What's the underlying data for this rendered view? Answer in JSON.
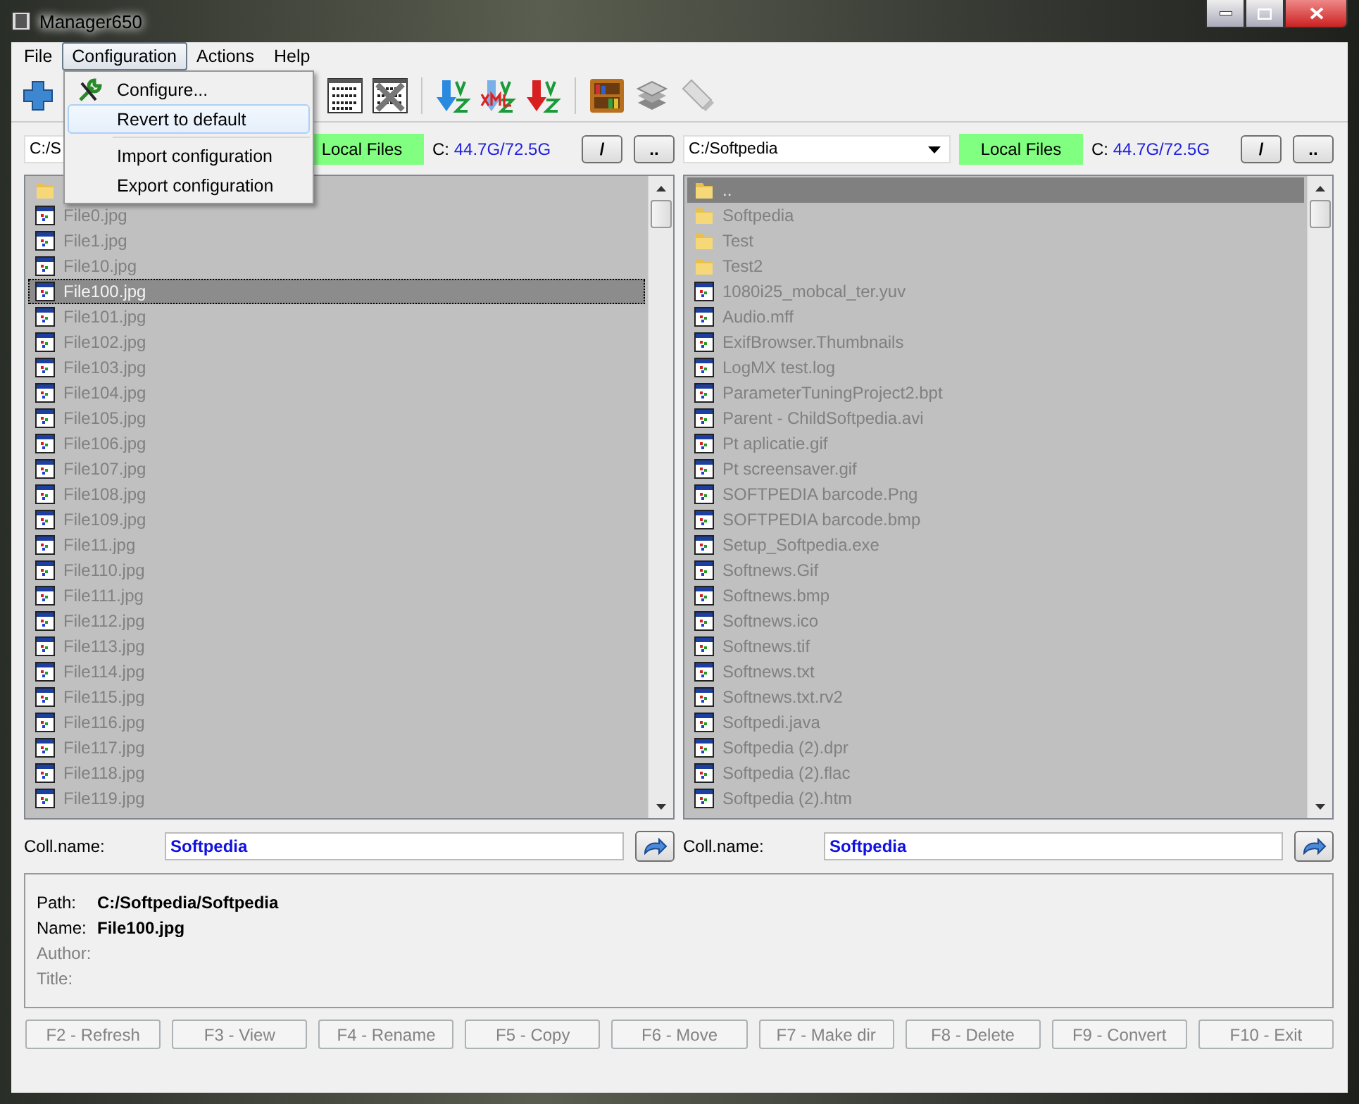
{
  "window": {
    "title": "Manager650"
  },
  "menubar": [
    {
      "label": "File",
      "selected": false
    },
    {
      "label": "Configuration",
      "selected": true
    },
    {
      "label": "Actions",
      "selected": false
    },
    {
      "label": "Help",
      "selected": false
    }
  ],
  "menu": {
    "items": [
      {
        "kind": "tool",
        "label": "Configure...",
        "selected": false
      },
      {
        "kind": "plain",
        "label": "Revert to default",
        "selected": true
      },
      {
        "kind": "separator"
      },
      {
        "kind": "plain",
        "label": "Import configuration",
        "selected": false
      },
      {
        "kind": "plain",
        "label": "Export configuration",
        "selected": false
      }
    ]
  },
  "toolbar": [
    {
      "kind": "add"
    },
    {
      "kind": "gap"
    },
    {
      "kind": "numbered"
    },
    {
      "kind": "numbered-off"
    },
    {
      "kind": "separator"
    },
    {
      "kind": "sort-blue"
    },
    {
      "kind": "sort-xml"
    },
    {
      "kind": "sort-red"
    },
    {
      "kind": "separator"
    },
    {
      "kind": "bookshelf"
    },
    {
      "kind": "stack"
    },
    {
      "kind": "usb"
    }
  ],
  "panels": [
    {
      "path": "C:/S",
      "source": "Local Files",
      "drive": "C:",
      "free": "44.7G/72.5G",
      "root_button": "/",
      "up_button": "..",
      "focused": true,
      "rows": [
        {
          "kind": "folder"
        },
        {
          "kind": "file",
          "name": "File0.jpg",
          "selected": false
        },
        {
          "kind": "file",
          "name": "File1.jpg",
          "selected": false
        },
        {
          "kind": "file",
          "name": "File10.jpg",
          "selected": false
        },
        {
          "kind": "file",
          "name": "File100.jpg",
          "selected": true
        },
        {
          "kind": "file",
          "name": "File101.jpg",
          "selected": false
        },
        {
          "kind": "file",
          "name": "File102.jpg",
          "selected": false
        },
        {
          "kind": "file",
          "name": "File103.jpg",
          "selected": false
        },
        {
          "kind": "file",
          "name": "File104.jpg",
          "selected": false
        },
        {
          "kind": "file",
          "name": "File105.jpg",
          "selected": false
        },
        {
          "kind": "file",
          "name": "File106.jpg",
          "selected": false
        },
        {
          "kind": "file",
          "name": "File107.jpg",
          "selected": false
        },
        {
          "kind": "file",
          "name": "File108.jpg",
          "selected": false
        },
        {
          "kind": "file",
          "name": "File109.jpg",
          "selected": false
        },
        {
          "kind": "file",
          "name": "File11.jpg",
          "selected": false
        },
        {
          "kind": "file",
          "name": "File110.jpg",
          "selected": false
        },
        {
          "kind": "file",
          "name": "File111.jpg",
          "selected": false
        },
        {
          "kind": "file",
          "name": "File112.jpg",
          "selected": false
        },
        {
          "kind": "file",
          "name": "File113.jpg",
          "selected": false
        },
        {
          "kind": "file",
          "name": "File114.jpg",
          "selected": false
        },
        {
          "kind": "file",
          "name": "File115.jpg",
          "selected": false
        },
        {
          "kind": "file",
          "name": "File116.jpg",
          "selected": false
        },
        {
          "kind": "file",
          "name": "File117.jpg",
          "selected": false
        },
        {
          "kind": "file",
          "name": "File118.jpg",
          "selected": false
        },
        {
          "kind": "file",
          "name": "File119.jpg",
          "selected": false
        }
      ],
      "coll_label": "Coll.name:",
      "coll_value": "Softpedia"
    },
    {
      "path": "C:/Softpedia",
      "source": "Local Files",
      "drive": "C:",
      "free": "44.7G/72.5G",
      "root_button": "/",
      "up_button": "..",
      "focused": false,
      "rows": [
        {
          "kind": "folder",
          "name": "..",
          "selected": true
        },
        {
          "kind": "folder",
          "name": "Softpedia",
          "selected": false
        },
        {
          "kind": "folder",
          "name": "Test",
          "selected": false
        },
        {
          "kind": "folder",
          "name": "Test2",
          "selected": false
        },
        {
          "kind": "file",
          "name": "1080i25_mobcal_ter.yuv",
          "selected": false
        },
        {
          "kind": "file",
          "name": "Audio.mff",
          "selected": false
        },
        {
          "kind": "file",
          "name": "ExifBrowser.Thumbnails",
          "selected": false
        },
        {
          "kind": "file",
          "name": "LogMX test.log",
          "selected": false
        },
        {
          "kind": "file",
          "name": "ParameterTuningProject2.bpt",
          "selected": false
        },
        {
          "kind": "file",
          "name": "Parent - ChildSoftpedia.avi",
          "selected": false
        },
        {
          "kind": "file",
          "name": "Pt aplicatie.gif",
          "selected": false
        },
        {
          "kind": "file",
          "name": "Pt screensaver.gif",
          "selected": false
        },
        {
          "kind": "file",
          "name": "SOFTPEDIA barcode.Png",
          "selected": false
        },
        {
          "kind": "file",
          "name": "SOFTPEDIA barcode.bmp",
          "selected": false
        },
        {
          "kind": "file",
          "name": "Setup_Softpedia.exe",
          "selected": false
        },
        {
          "kind": "file",
          "name": "Softnews.Gif",
          "selected": false
        },
        {
          "kind": "file",
          "name": "Softnews.bmp",
          "selected": false
        },
        {
          "kind": "file",
          "name": "Softnews.ico",
          "selected": false
        },
        {
          "kind": "file",
          "name": "Softnews.tif",
          "selected": false
        },
        {
          "kind": "file",
          "name": "Softnews.txt",
          "selected": false
        },
        {
          "kind": "file",
          "name": "Softnews.txt.rv2",
          "selected": false
        },
        {
          "kind": "file",
          "name": "Softpedi.java",
          "selected": false
        },
        {
          "kind": "file",
          "name": "Softpedia (2).dpr",
          "selected": false
        },
        {
          "kind": "file",
          "name": "Softpedia (2).flac",
          "selected": false
        },
        {
          "kind": "file",
          "name": "Softpedia (2).htm",
          "selected": false
        }
      ],
      "coll_label": "Coll.name:",
      "coll_value": "Softpedia"
    }
  ],
  "info": [
    {
      "label": "Path:",
      "value": "C:/Softpedia/Softpedia",
      "disabled": false
    },
    {
      "label": "Name:",
      "value": "File100.jpg",
      "disabled": false
    },
    {
      "label": "Author:",
      "disabled": true
    },
    {
      "label": "Title:",
      "disabled": true
    }
  ],
  "buttons": [
    {
      "label": "F2 - Refresh",
      "disabled": true
    },
    {
      "label": "F3 - View",
      "disabled": true
    },
    {
      "label": "F4 - Rename",
      "disabled": true
    },
    {
      "label": "F5 - Copy",
      "disabled": true
    },
    {
      "label": "F6 - Move",
      "disabled": true
    },
    {
      "label": "F7 - Make dir",
      "disabled": true
    },
    {
      "label": "F8 - Delete",
      "disabled": true
    },
    {
      "label": "F9 - Convert",
      "disabled": true
    },
    {
      "label": "F10 - Exit",
      "disabled": true
    }
  ]
}
